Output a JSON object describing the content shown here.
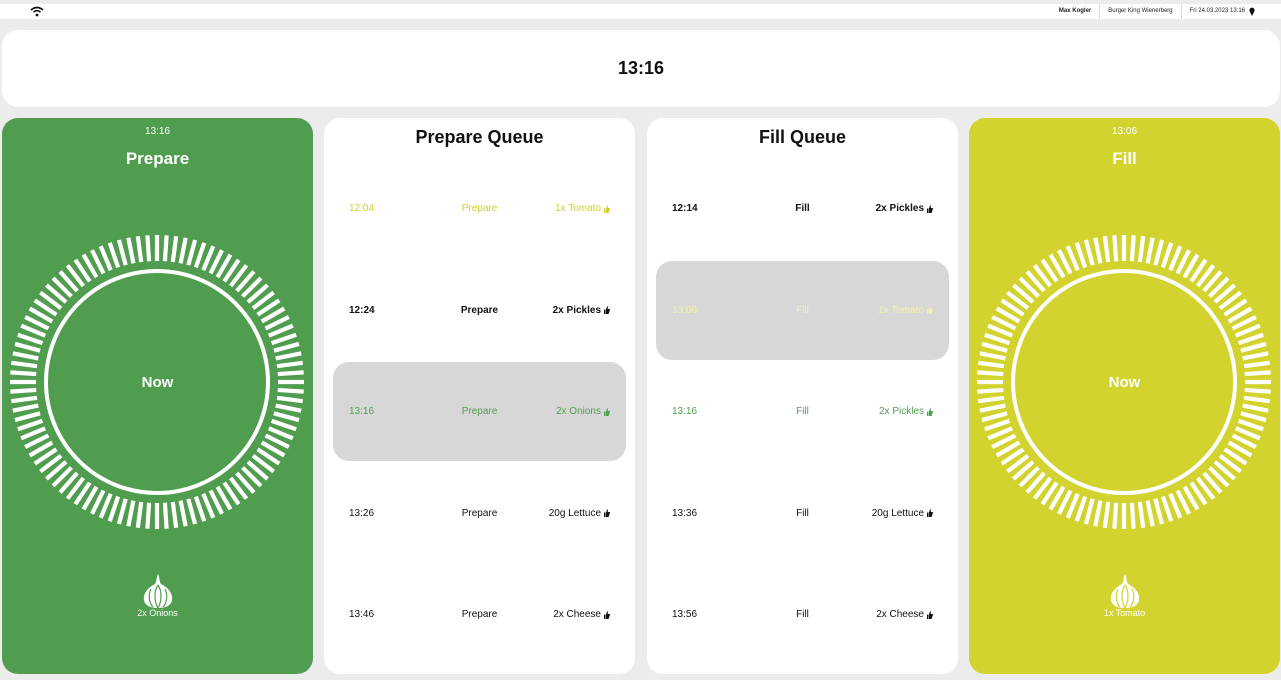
{
  "status_bar": {
    "user": "Max Kogler",
    "location": "Burger King Wienerberg",
    "datetime": "Fri 24.03.2023 13:16"
  },
  "header": {
    "clock": "13:16"
  },
  "prepare_panel": {
    "time": "13:16",
    "title": "Prepare",
    "center_label": "Now",
    "item": "2x Onions",
    "color": "#519d4f"
  },
  "prepare_queue": {
    "title": "Prepare Queue",
    "rows": [
      {
        "time": "12:04",
        "action": "Prepare",
        "item": "1x Tomato",
        "style": "yellow"
      },
      {
        "time": "12:24",
        "action": "Prepare",
        "item": "2x Pickles",
        "style": "bold"
      },
      {
        "time": "13:16",
        "action": "Prepare",
        "item": "2x Onions",
        "style": "green selected"
      },
      {
        "time": "13:26",
        "action": "Prepare",
        "item": "20g Lettuce",
        "style": "normal"
      },
      {
        "time": "13:46",
        "action": "Prepare",
        "item": "2x Cheese",
        "style": "normal"
      }
    ]
  },
  "fill_queue": {
    "title": "Fill Queue",
    "rows": [
      {
        "time": "12:14",
        "action": "Fill",
        "item": "2x Pickles",
        "style": "bold"
      },
      {
        "time": "13:06",
        "action": "Fill",
        "item": "1x Tomato",
        "style": "dim selected"
      },
      {
        "time": "13:16",
        "action": "Fill",
        "item": "2x Pickles",
        "style": "green"
      },
      {
        "time": "13:36",
        "action": "Fill",
        "item": "20g Lettuce",
        "style": "normal"
      },
      {
        "time": "13:56",
        "action": "Fill",
        "item": "2x Cheese",
        "style": "normal"
      }
    ]
  },
  "fill_panel": {
    "time": "13:06",
    "title": "Fill",
    "center_label": "Now",
    "item": "1x Tomato",
    "color": "#d3d330"
  },
  "icons": {
    "status": [
      "wifi-icon",
      "location-pin-icon"
    ],
    "queue_item": "thumb-icon",
    "panel_item": "garlic-icon"
  }
}
